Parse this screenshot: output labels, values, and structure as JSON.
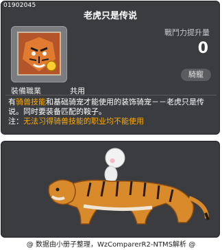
{
  "item_id": "01902045",
  "title": "老虎只是传说",
  "icon": {
    "name": "tiger-item-icon",
    "accent_color": "#ffaa00"
  },
  "stat": {
    "label": "戰鬥力提升量",
    "value": "0"
  },
  "category_badge": "騎寵",
  "job": {
    "label": "裝備職業",
    "value": "共用"
  },
  "description": {
    "prefix": "有",
    "skill_link": "骑兽技能",
    "middle": "和基础骑宠才能使用的装饰骑宠－－老虎只是传说。同时要装备匹配的鞍子。",
    "note_label": "注：",
    "note_text": "无法习得骑兽技能的职业均不能使用"
  },
  "preview": {
    "name": "tiger-mount-preview"
  },
  "footer_credit": "@ 数据由小册子整理，WzComparerR2-NTMS解析 @"
}
